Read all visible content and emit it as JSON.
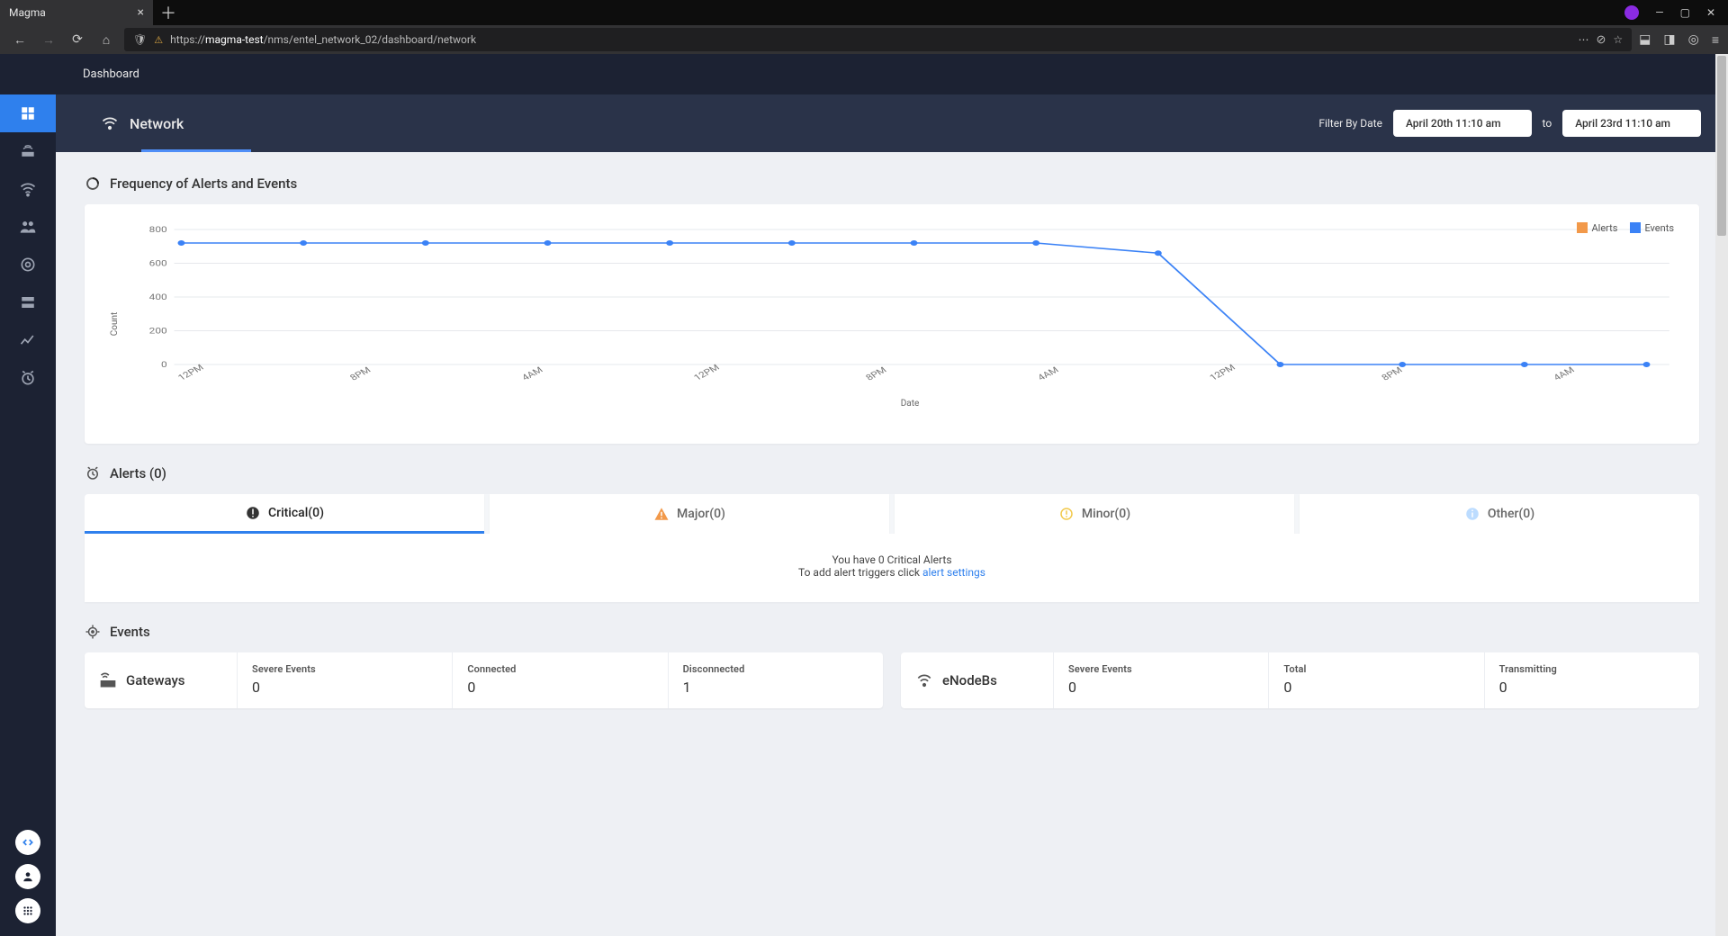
{
  "browser": {
    "tab_title": "Magma",
    "url_prefix": "https://",
    "url_host": "magma-test",
    "url_path": "/nms/entel_network_02/dashboard/network"
  },
  "topbar": {
    "title": "Dashboard"
  },
  "header": {
    "section": "Network",
    "filter_label": "Filter By Date",
    "date_from": "April 20th 11:10 am",
    "date_sep": "to",
    "date_to": "April 23rd 11:10 am"
  },
  "chart_section": {
    "title": "Frequency of Alerts and Events"
  },
  "chart_data": {
    "type": "line",
    "title": "Frequency of Alerts and Events",
    "xlabel": "Date",
    "ylabel": "Count",
    "ylim": [
      0,
      800
    ],
    "yticks": [
      0,
      200,
      400,
      600,
      800
    ],
    "x_tick_labels": [
      "12PM",
      "8PM",
      "4AM",
      "12PM",
      "8PM",
      "4AM",
      "12PM",
      "8PM",
      "4AM"
    ],
    "series": [
      {
        "name": "Alerts",
        "color": "#f2994a",
        "values": []
      },
      {
        "name": "Events",
        "color": "#3b82f6",
        "values": [
          720,
          720,
          720,
          720,
          720,
          720,
          720,
          720,
          660,
          0,
          0,
          0,
          0
        ]
      }
    ],
    "legend": [
      {
        "label": "Alerts",
        "color": "#f2994a"
      },
      {
        "label": "Events",
        "color": "#3b82f6"
      }
    ]
  },
  "alerts": {
    "title": "Alerts (0)",
    "tabs": [
      {
        "label": "Critical(0)",
        "icon": "error",
        "color": "#333333"
      },
      {
        "label": "Major(0)",
        "icon": "warn",
        "color": "#f2994a"
      },
      {
        "label": "Minor(0)",
        "icon": "warn-outline",
        "color": "#f2c94c"
      },
      {
        "label": "Other(0)",
        "icon": "info",
        "color": "#bcdcff"
      }
    ],
    "empty_line1": "You have 0 Critical Alerts",
    "empty_line2_prefix": "To add alert triggers click ",
    "empty_link": "alert settings"
  },
  "events": {
    "title": "Events",
    "cards": [
      {
        "heading": "Gateways",
        "icon": "gateway",
        "cells": [
          {
            "label": "Severe Events",
            "value": "0"
          },
          {
            "label": "Connected",
            "value": "0"
          },
          {
            "label": "Disconnected",
            "value": "1"
          }
        ]
      },
      {
        "heading": "eNodeBs",
        "icon": "enodeb",
        "cells": [
          {
            "label": "Severe Events",
            "value": "0"
          },
          {
            "label": "Total",
            "value": "0"
          },
          {
            "label": "Transmitting",
            "value": "0"
          }
        ]
      }
    ]
  },
  "sidebar": {
    "items": [
      "dashboard",
      "equipment",
      "wifi",
      "subscribers",
      "target",
      "storage",
      "metrics",
      "alarms"
    ]
  }
}
